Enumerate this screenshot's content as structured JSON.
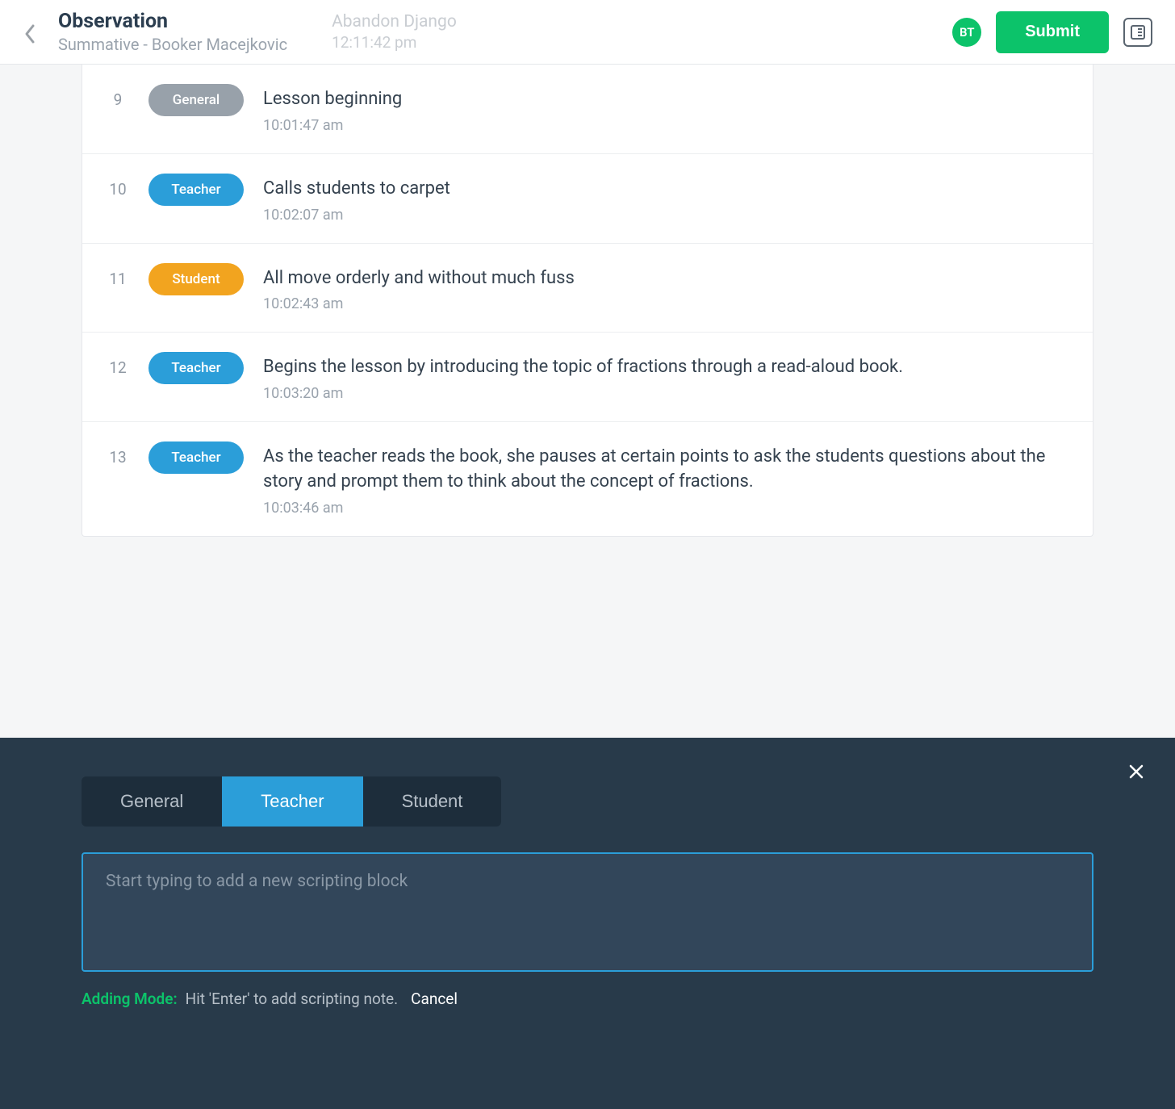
{
  "header": {
    "title": "Observation",
    "subtitle": "Summative - Booker Macejkovic",
    "faded_note_text": "Abandon Django",
    "faded_note_time": "12:11:42 pm",
    "avatar": "BT",
    "submit_label": "Submit"
  },
  "notes": [
    {
      "num": "9",
      "tag": "General",
      "tag_class": "tag-general",
      "text": "Lesson beginning",
      "time": "10:01:47 am"
    },
    {
      "num": "10",
      "tag": "Teacher",
      "tag_class": "tag-teacher",
      "text": "Calls students to carpet",
      "time": "10:02:07 am"
    },
    {
      "num": "11",
      "tag": "Student",
      "tag_class": "tag-student",
      "text": "All move orderly and without much fuss",
      "time": "10:02:43 am"
    },
    {
      "num": "12",
      "tag": "Teacher",
      "tag_class": "tag-teacher",
      "text": "Begins the lesson by introducing the topic of fractions through a read-aloud book.",
      "time": "10:03:20 am"
    },
    {
      "num": "13",
      "tag": "Teacher",
      "tag_class": "tag-teacher",
      "text": "As the teacher reads the book, she pauses at certain points to ask the students questions about the story and prompt them to think about the concept of fractions.",
      "time": "10:03:46 am"
    }
  ],
  "drawer": {
    "tabs": [
      {
        "label": "General",
        "active": false
      },
      {
        "label": "Teacher",
        "active": true
      },
      {
        "label": "Student",
        "active": false
      }
    ],
    "input_placeholder": "Start typing to add a new scripting block",
    "mode_label": "Adding Mode:",
    "mode_hint": "Hit 'Enter' to add scripting note.",
    "cancel_label": "Cancel"
  }
}
